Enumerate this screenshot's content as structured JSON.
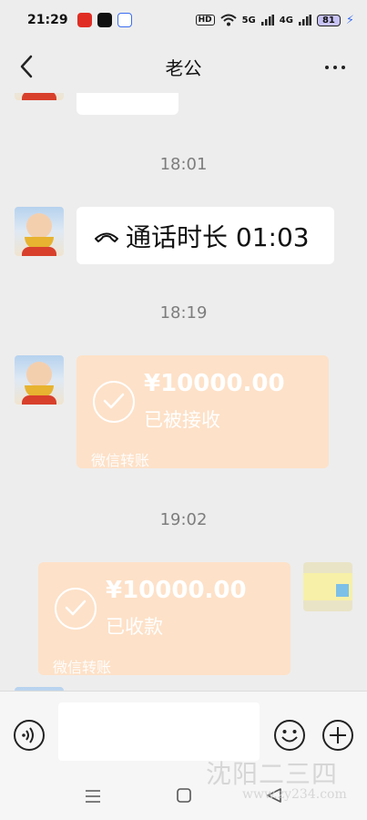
{
  "status_bar": {
    "time": "21:29",
    "hd_label": "HD",
    "net1": "5G",
    "net2": "4G",
    "battery": "81",
    "icons": [
      "pinduoduo-icon",
      "douyin-icon",
      "baidu-icon",
      "wifi-icon",
      "signal-icon",
      "battery-icon"
    ]
  },
  "header": {
    "title": "老公"
  },
  "messages": [
    {
      "type": "timestamp",
      "text": "18:01"
    },
    {
      "type": "call",
      "side": "left",
      "icon": "phone-icon",
      "text": "通话时长 01:03"
    },
    {
      "type": "timestamp",
      "text": "18:19"
    },
    {
      "type": "transfer",
      "side": "left",
      "amount": "¥10000.00",
      "status": "已被接收",
      "footer": "微信转账"
    },
    {
      "type": "timestamp",
      "text": "19:02"
    },
    {
      "type": "transfer",
      "side": "right",
      "amount": "¥10000.00",
      "status": "已收款",
      "footer": "微信转账"
    }
  ],
  "input_bar": {
    "value": "",
    "icons": [
      "voice-icon",
      "emoji-icon",
      "plus-icon"
    ]
  },
  "watermark": {
    "line1": "沈阳二三四",
    "line2": "www.zy234.com"
  },
  "colors": {
    "background": "#ededed",
    "transfer_bubble": "#fde1c8",
    "bubble": "#ffffff"
  }
}
